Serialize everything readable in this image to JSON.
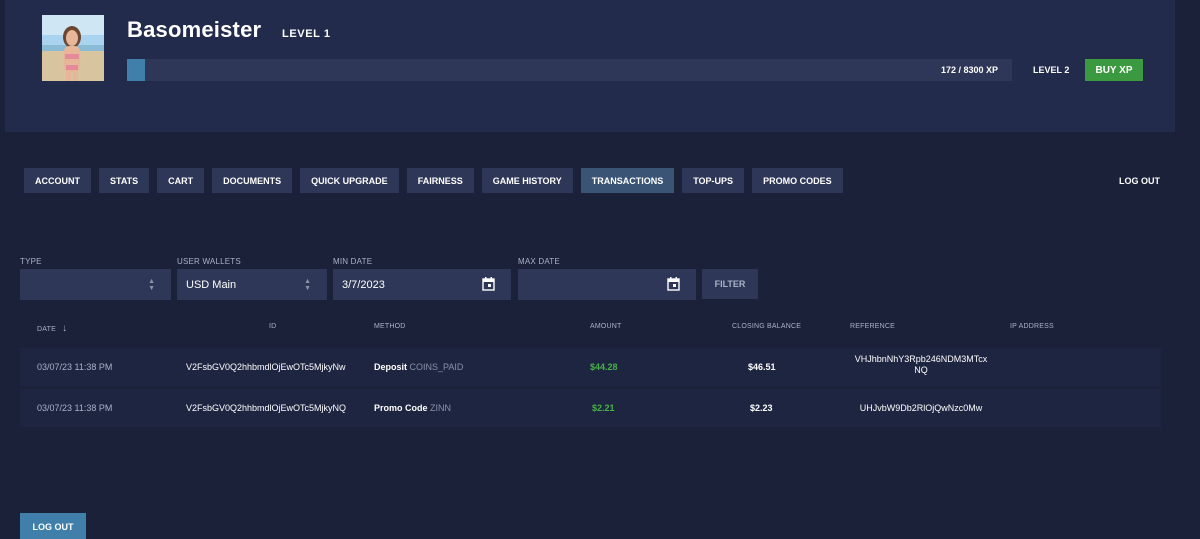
{
  "profile": {
    "username": "Basomeister",
    "level_label": "LEVEL 1",
    "xp_text": "172 / 8300 XP",
    "xp_progress": 0.0207,
    "next_level_label": "LEVEL 2",
    "buy_xp_label": "BUY XP"
  },
  "tabs": [
    "ACCOUNT",
    "STATS",
    "CART",
    "DOCUMENTS",
    "QUICK UPGRADE",
    "FAIRNESS",
    "GAME HISTORY",
    "TRANSACTIONS",
    "TOP-UPS",
    "PROMO CODES"
  ],
  "active_tab": "TRANSACTIONS",
  "logout_top": "LOG OUT",
  "filters": {
    "type_label": "TYPE",
    "type_value": "",
    "wallet_label": "USER WALLETS",
    "wallet_value": "USD Main",
    "min_date_label": "MIN DATE",
    "min_date_value": "3/7/2023",
    "max_date_label": "MAX DATE",
    "max_date_value": "",
    "filter_button": "FILTER"
  },
  "table": {
    "headers": {
      "date": "DATE",
      "id": "ID",
      "method": "METHOD",
      "amount": "AMOUNT",
      "closing_balance": "CLOSING BALANCE",
      "reference": "REFERENCE",
      "ip_address": "IP ADDRESS"
    },
    "rows": [
      {
        "date": "03/07/23 11:38 PM",
        "id": "V2FsbGV0Q2hhbmdlOjEwOTc5MjkyNw",
        "method_main": "Deposit",
        "method_sub": "COINS_PAID",
        "amount": "$44.28",
        "closing_balance": "$46.51",
        "reference_line1": "VHJhbnNhY3Rpb246NDM3MTcx",
        "reference_line2": "NQ",
        "ip_address": ""
      },
      {
        "date": "03/07/23 11:38 PM",
        "id": "V2FsbGV0Q2hhbmdlOjEwOTc5MjkyNQ",
        "method_main": "Promo Code",
        "method_sub": "ZINN",
        "amount": "$2.21",
        "closing_balance": "$2.23",
        "reference_line1": "UHJvbW9Db2RlOjQwNzc0Mw",
        "reference_line2": "",
        "ip_address": ""
      }
    ]
  },
  "logout_bottom": "LOG OUT",
  "colors": {
    "background": "#1b2139",
    "card": "#232b4c",
    "panel": "#2e3757",
    "accent_blue": "#3f7fa9",
    "buy_green": "#3b9a3f",
    "amount_green": "#47b04b"
  }
}
